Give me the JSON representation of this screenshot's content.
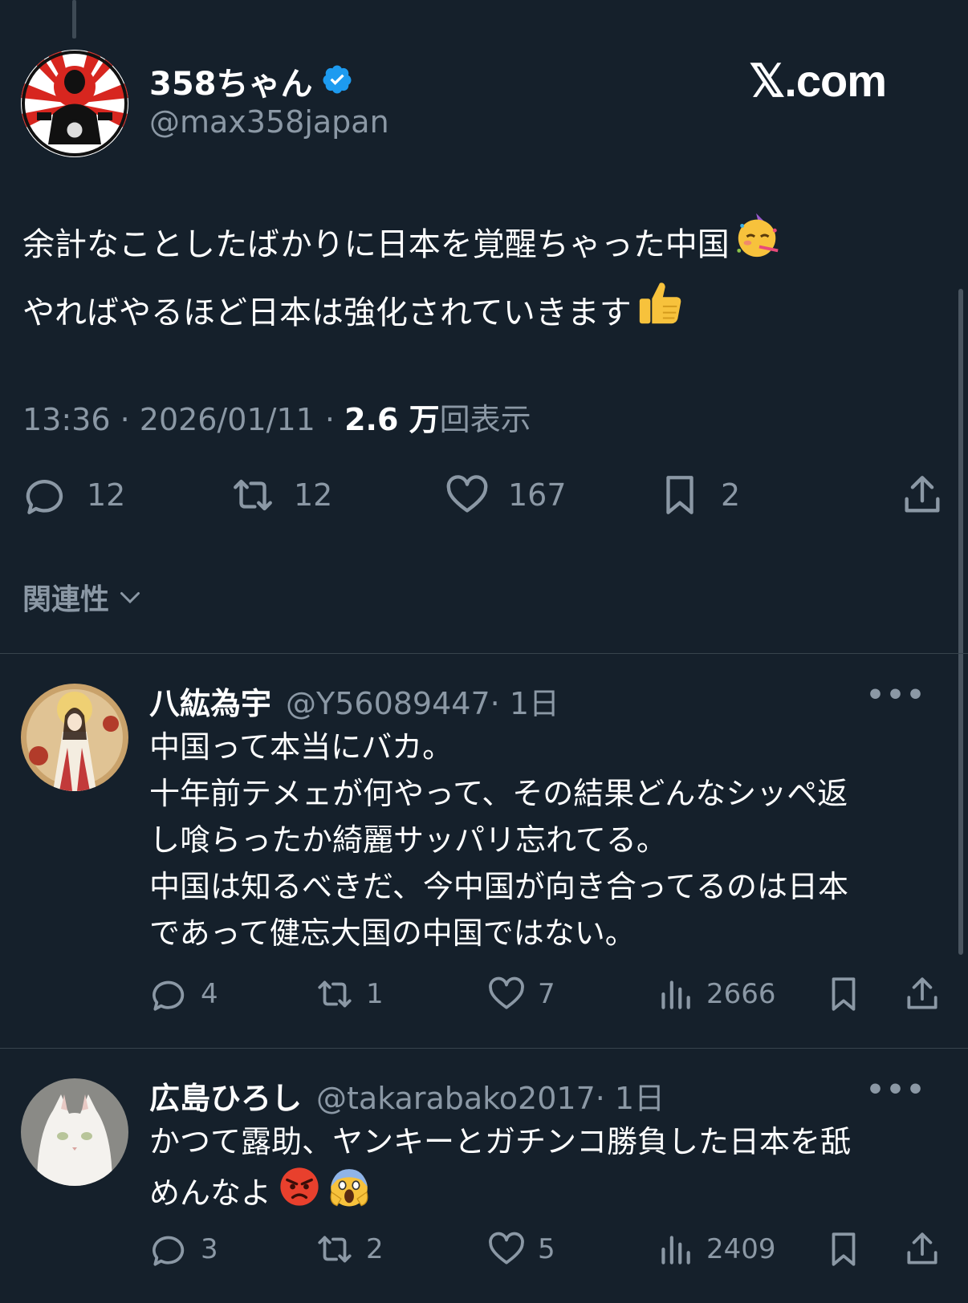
{
  "main": {
    "name": "358ちゃん",
    "handle": "@max358japan",
    "brand": "𝕏.com",
    "text_line1": "余計なことしたばかりに日本を覚醒ちゃった中国",
    "text_line2": "やればやるほど日本は強化されていきます",
    "emoji1": "partying-face",
    "emoji2": "thumbs-up",
    "time": "13:36",
    "date": "2026/01/11",
    "views": "2.6 万",
    "views_label": "回表示",
    "replies": "12",
    "reposts": "12",
    "likes": "167",
    "bookmarks": "2",
    "relevance": "関連性"
  },
  "replies": [
    {
      "name": "八紘為宇",
      "handle": "@Y56089447",
      "age": "· 1日",
      "text": [
        "中国って本当にバカ。",
        "十年前テメェが何やって、その結果どんなシッペ返",
        "し喰らったか綺麗サッパリ忘れてる。",
        "中国は知るべきだ、今中国が向き合ってるのは日本",
        "であって健忘大国の中国ではない。"
      ],
      "replies": "4",
      "reposts": "1",
      "likes": "7",
      "views": "2666"
    },
    {
      "name": "広島ひろし",
      "handle": "@takarabako2017",
      "age": "· 1日",
      "text": [
        "かつて露助、ヤンキーとガチンコ勝負した日本を舐",
        "めんなよ"
      ],
      "emojis": [
        "angry-face",
        "screaming-face"
      ],
      "replies": "3",
      "reposts": "2",
      "likes": "5",
      "views": "2409"
    }
  ],
  "colors": {
    "background": "#15202b",
    "muted": "#8b98a5",
    "verified": "#1d9bf0"
  }
}
